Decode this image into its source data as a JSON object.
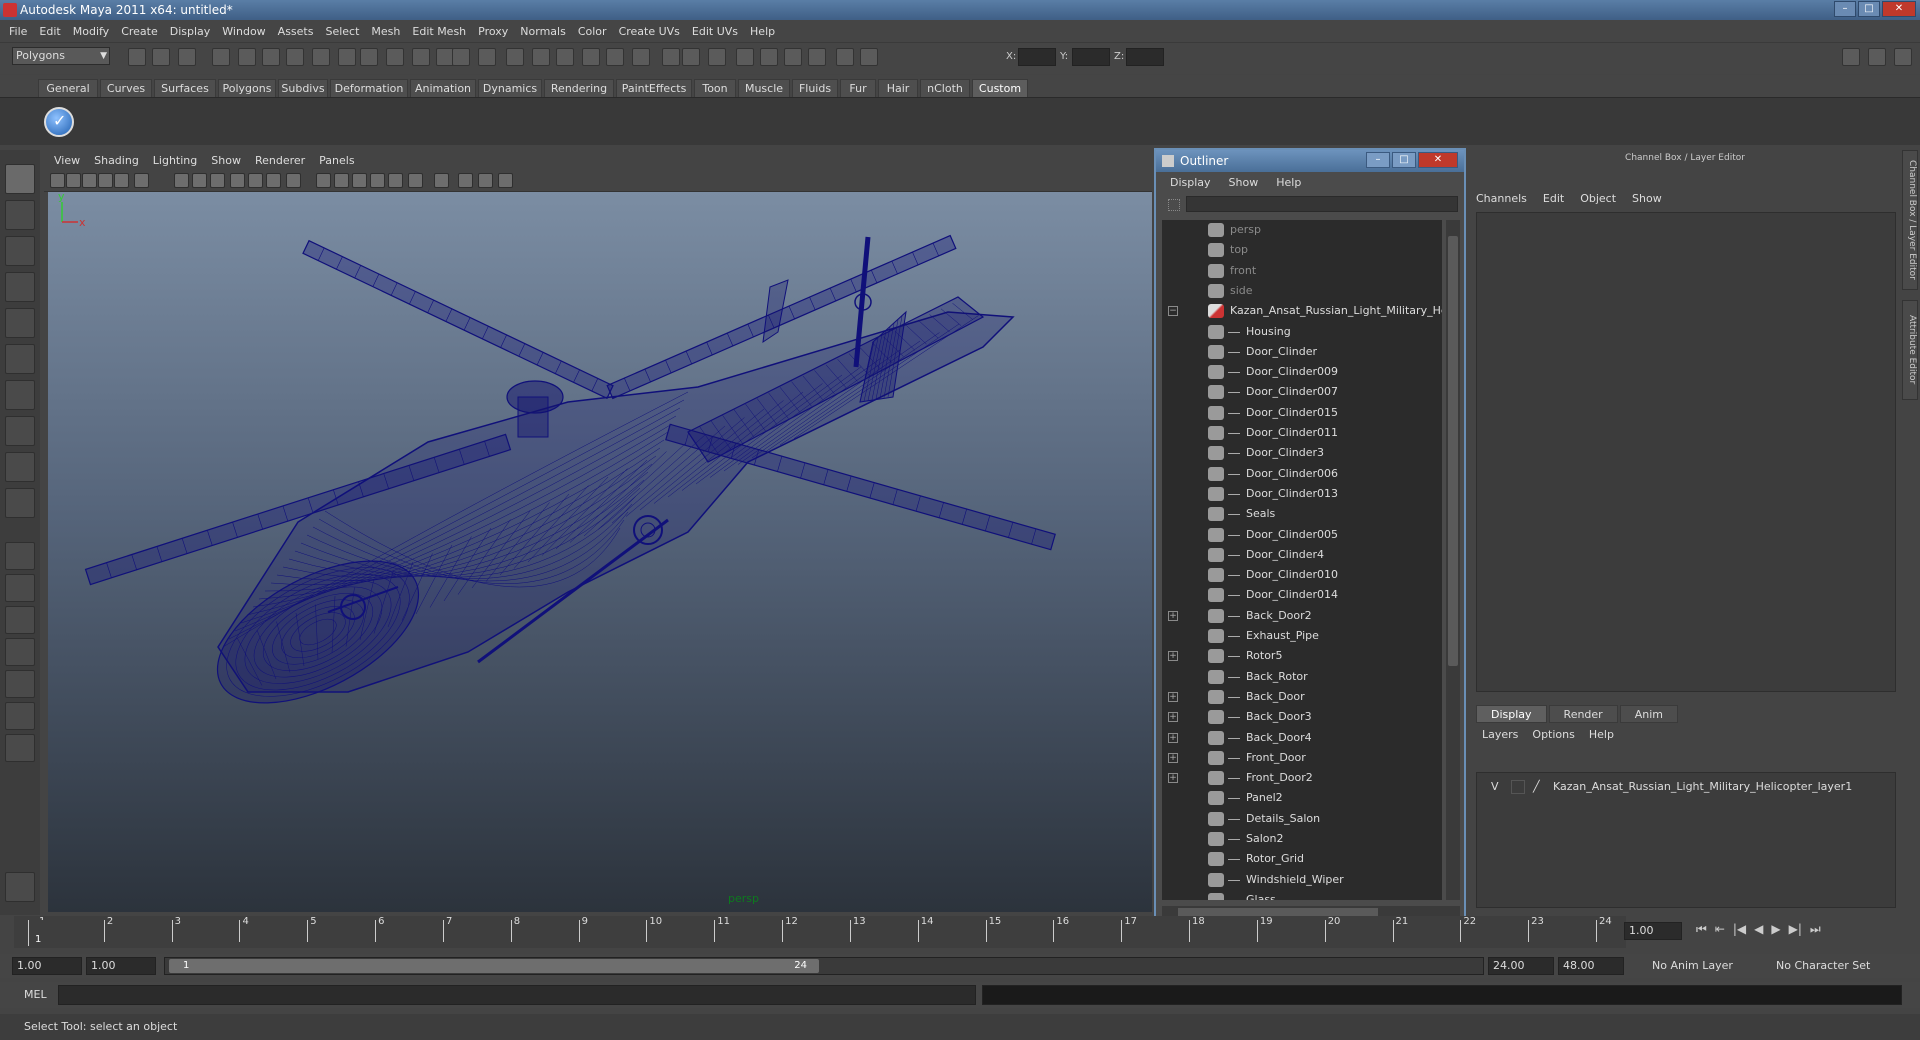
{
  "window": {
    "title": "Autodesk Maya 2011 x64: untitled*"
  },
  "menubar": [
    "File",
    "Edit",
    "Modify",
    "Create",
    "Display",
    "Window",
    "Assets",
    "Select",
    "Mesh",
    "Edit Mesh",
    "Proxy",
    "Normals",
    "Color",
    "Create UVs",
    "Edit UVs",
    "Help"
  ],
  "statusline": {
    "mode": "Polygons",
    "x_label": "X:",
    "y_label": "Y:",
    "z_label": "Z:"
  },
  "shelf": {
    "tabs": [
      "General",
      "Curves",
      "Surfaces",
      "Polygons",
      "Subdivs",
      "Deformation",
      "Animation",
      "Dynamics",
      "Rendering",
      "PaintEffects",
      "Toon",
      "Muscle",
      "Fluids",
      "Fur",
      "Hair",
      "nCloth",
      "Custom"
    ],
    "active_tab": "Custom"
  },
  "viewport": {
    "menu": [
      "View",
      "Shading",
      "Lighting",
      "Show",
      "Renderer",
      "Panels"
    ],
    "camera": "persp",
    "axis_y": "y",
    "axis_x": "x",
    "wire_color": "#10107a"
  },
  "outliner": {
    "title": "Outliner",
    "menu": [
      "Display",
      "Show",
      "Help"
    ],
    "items": [
      {
        "label": "persp",
        "kind": "camera",
        "indent": 0,
        "expand": false
      },
      {
        "label": "top",
        "kind": "camera",
        "indent": 0,
        "expand": false
      },
      {
        "label": "front",
        "kind": "camera",
        "indent": 0,
        "expand": false
      },
      {
        "label": "side",
        "kind": "camera",
        "indent": 0,
        "expand": false
      },
      {
        "label": "Kazan_Ansat_Russian_Light_Military_Helic",
        "kind": "group",
        "indent": 0,
        "expand": "minus"
      },
      {
        "label": "Housing",
        "kind": "mesh",
        "indent": 1,
        "expand": false
      },
      {
        "label": "Door_Clinder",
        "kind": "mesh",
        "indent": 1,
        "expand": false
      },
      {
        "label": "Door_Clinder009",
        "kind": "mesh",
        "indent": 1,
        "expand": false
      },
      {
        "label": "Door_Clinder007",
        "kind": "mesh",
        "indent": 1,
        "expand": false
      },
      {
        "label": "Door_Clinder015",
        "kind": "mesh",
        "indent": 1,
        "expand": false
      },
      {
        "label": "Door_Clinder011",
        "kind": "mesh",
        "indent": 1,
        "expand": false
      },
      {
        "label": "Door_Clinder3",
        "kind": "mesh",
        "indent": 1,
        "expand": false
      },
      {
        "label": "Door_Clinder006",
        "kind": "mesh",
        "indent": 1,
        "expand": false
      },
      {
        "label": "Door_Clinder013",
        "kind": "mesh",
        "indent": 1,
        "expand": false
      },
      {
        "label": "Seals",
        "kind": "mesh",
        "indent": 1,
        "expand": false
      },
      {
        "label": "Door_Clinder005",
        "kind": "mesh",
        "indent": 1,
        "expand": false
      },
      {
        "label": "Door_Clinder4",
        "kind": "mesh",
        "indent": 1,
        "expand": false
      },
      {
        "label": "Door_Clinder010",
        "kind": "mesh",
        "indent": 1,
        "expand": false
      },
      {
        "label": "Door_Clinder014",
        "kind": "mesh",
        "indent": 1,
        "expand": false
      },
      {
        "label": "Back_Door2",
        "kind": "mesh",
        "indent": 1,
        "expand": "plus"
      },
      {
        "label": "Exhaust_Pipe",
        "kind": "mesh",
        "indent": 1,
        "expand": false
      },
      {
        "label": "Rotor5",
        "kind": "mesh",
        "indent": 1,
        "expand": "plus"
      },
      {
        "label": "Back_Rotor",
        "kind": "mesh",
        "indent": 1,
        "expand": false
      },
      {
        "label": "Back_Door",
        "kind": "mesh",
        "indent": 1,
        "expand": "plus"
      },
      {
        "label": "Back_Door3",
        "kind": "mesh",
        "indent": 1,
        "expand": "plus"
      },
      {
        "label": "Back_Door4",
        "kind": "mesh",
        "indent": 1,
        "expand": "plus"
      },
      {
        "label": "Front_Door",
        "kind": "mesh",
        "indent": 1,
        "expand": "plus"
      },
      {
        "label": "Front_Door2",
        "kind": "mesh",
        "indent": 1,
        "expand": "plus"
      },
      {
        "label": "Panel2",
        "kind": "mesh",
        "indent": 1,
        "expand": false
      },
      {
        "label": "Details_Salon",
        "kind": "mesh",
        "indent": 1,
        "expand": false
      },
      {
        "label": "Salon2",
        "kind": "mesh",
        "indent": 1,
        "expand": false
      },
      {
        "label": "Rotor_Grid",
        "kind": "mesh",
        "indent": 1,
        "expand": false
      },
      {
        "label": "Windshield_Wiper",
        "kind": "mesh",
        "indent": 1,
        "expand": false
      },
      {
        "label": "Glass",
        "kind": "mesh",
        "indent": 1,
        "expand": false
      }
    ]
  },
  "channelbox": {
    "header": "Channel Box / Layer Editor",
    "menu": [
      "Channels",
      "Edit",
      "Object",
      "Show"
    ],
    "layer_tabs": [
      "Display",
      "Render",
      "Anim"
    ],
    "active_layer_tab": "Display",
    "layer_menu": [
      "Layers",
      "Options",
      "Help"
    ],
    "layer": {
      "visible": "V",
      "name": "Kazan_Ansat_Russian_Light_Military_Helicopter_layer1"
    },
    "side_tabs": [
      "Channel Box / Layer Editor",
      "Attribute Editor"
    ]
  },
  "timeline": {
    "ticks": [
      "1",
      "2",
      "3",
      "4",
      "5",
      "6",
      "7",
      "8",
      "9",
      "10",
      "11",
      "12",
      "13",
      "14",
      "15",
      "16",
      "17",
      "18",
      "19",
      "20",
      "21",
      "22",
      "23",
      "24"
    ],
    "current_marker": "1",
    "current_frame": "1.00"
  },
  "range": {
    "start_time": "1.00",
    "playback_start": "1.00",
    "slider_start": "1",
    "slider_end": "24",
    "playback_end": "24.00",
    "end_time": "48.00",
    "anim_layer": "No Anim Layer",
    "character_set": "No Character Set"
  },
  "commandline": {
    "label": "MEL"
  },
  "helpline": {
    "text": "Select Tool: select an object"
  }
}
